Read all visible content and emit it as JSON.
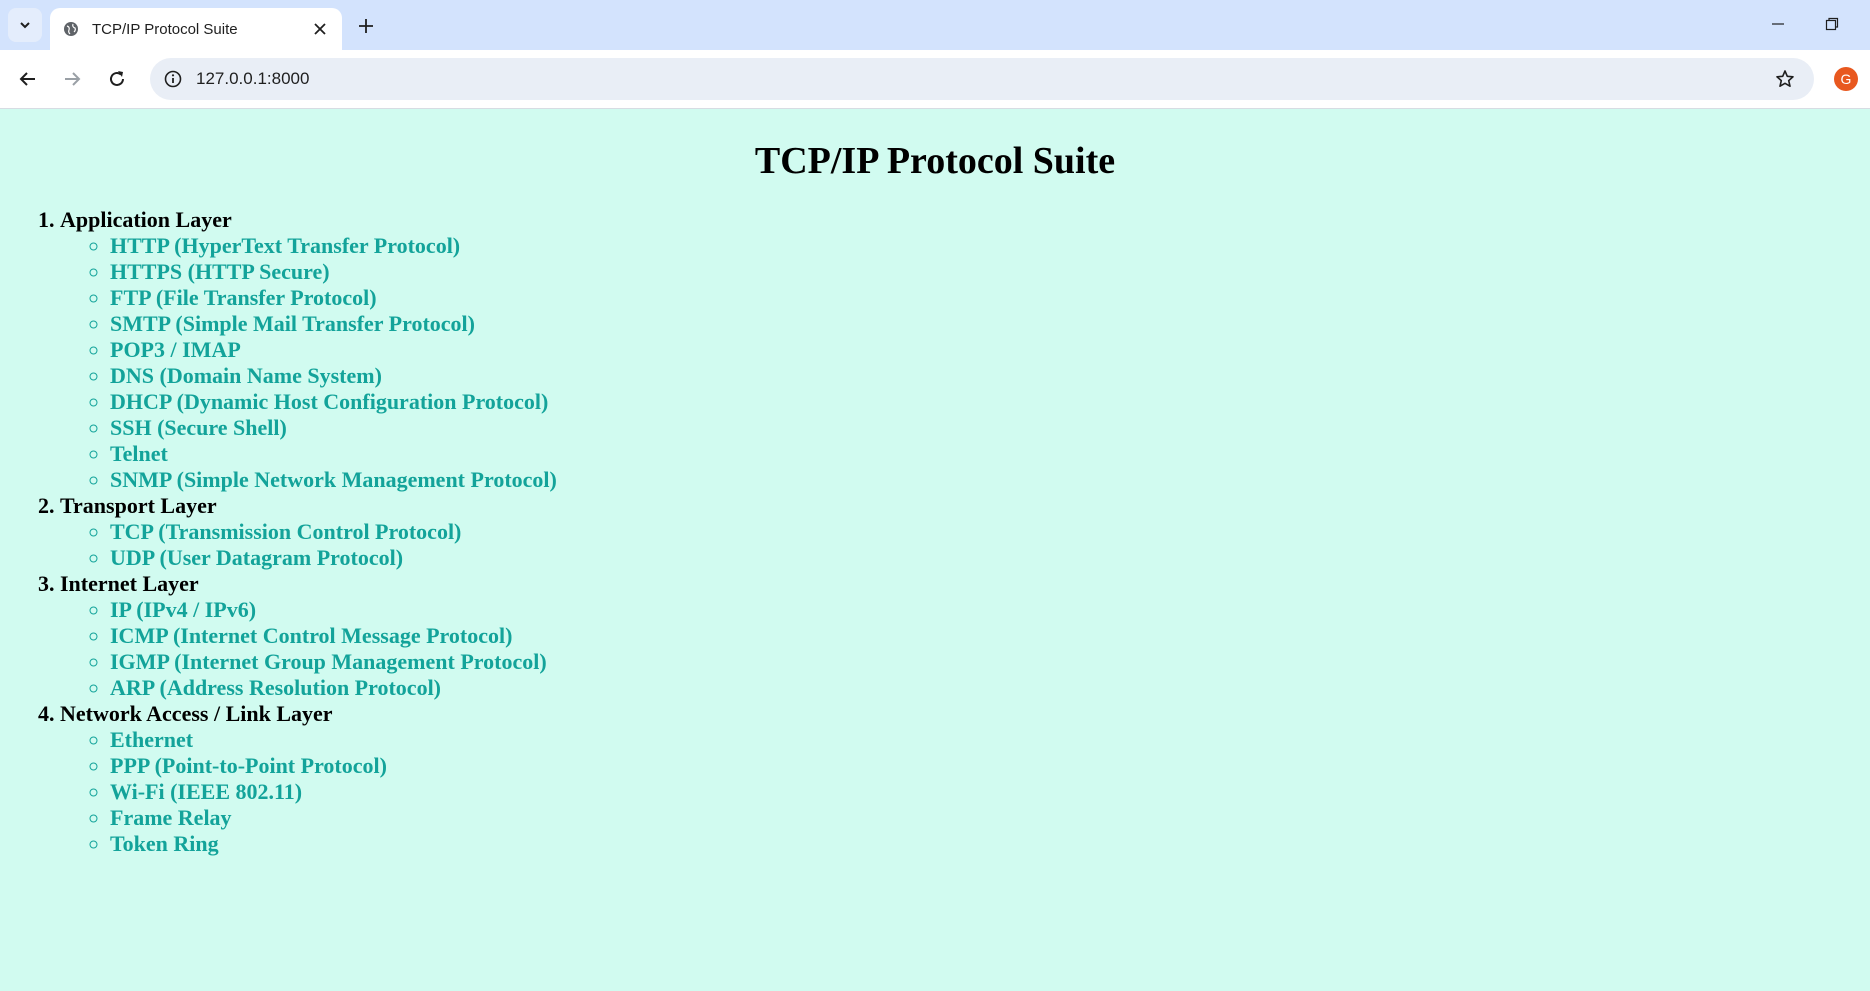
{
  "browser": {
    "tab_title": "TCP/IP Protocol Suite",
    "url": "127.0.0.1:8000",
    "avatar_letter": "G",
    "icons": {
      "tab_search": "chevron-down-icon",
      "favicon": "globe-icon",
      "tab_close": "close-icon",
      "new_tab": "plus-icon",
      "minimize": "minimize-icon",
      "restore": "restore-icon",
      "back": "back-arrow-icon",
      "forward": "forward-arrow-icon",
      "reload": "reload-icon",
      "site_info": "info-icon",
      "bookmark": "star-icon"
    }
  },
  "page": {
    "title": "TCP/IP Protocol Suite",
    "colors": {
      "background": "#d1fbf0",
      "protocol_text": "#13a39a",
      "heading_text": "#000000"
    },
    "layers": [
      {
        "name": "Application Layer",
        "protocols": [
          "HTTP (HyperText Transfer Protocol)",
          "HTTPS (HTTP Secure)",
          "FTP (File Transfer Protocol)",
          "SMTP (Simple Mail Transfer Protocol)",
          "POP3 / IMAP",
          "DNS (Domain Name System)",
          "DHCP (Dynamic Host Configuration Protocol)",
          "SSH (Secure Shell)",
          "Telnet",
          "SNMP (Simple Network Management Protocol)"
        ]
      },
      {
        "name": "Transport Layer",
        "protocols": [
          "TCP (Transmission Control Protocol)",
          "UDP (User Datagram Protocol)"
        ]
      },
      {
        "name": "Internet Layer",
        "protocols": [
          "IP (IPv4 / IPv6)",
          "ICMP (Internet Control Message Protocol)",
          "IGMP (Internet Group Management Protocol)",
          "ARP (Address Resolution Protocol)"
        ]
      },
      {
        "name": "Network Access / Link Layer",
        "protocols": [
          "Ethernet",
          "PPP (Point-to-Point Protocol)",
          "Wi-Fi (IEEE 802.11)",
          "Frame Relay",
          "Token Ring"
        ]
      }
    ]
  }
}
